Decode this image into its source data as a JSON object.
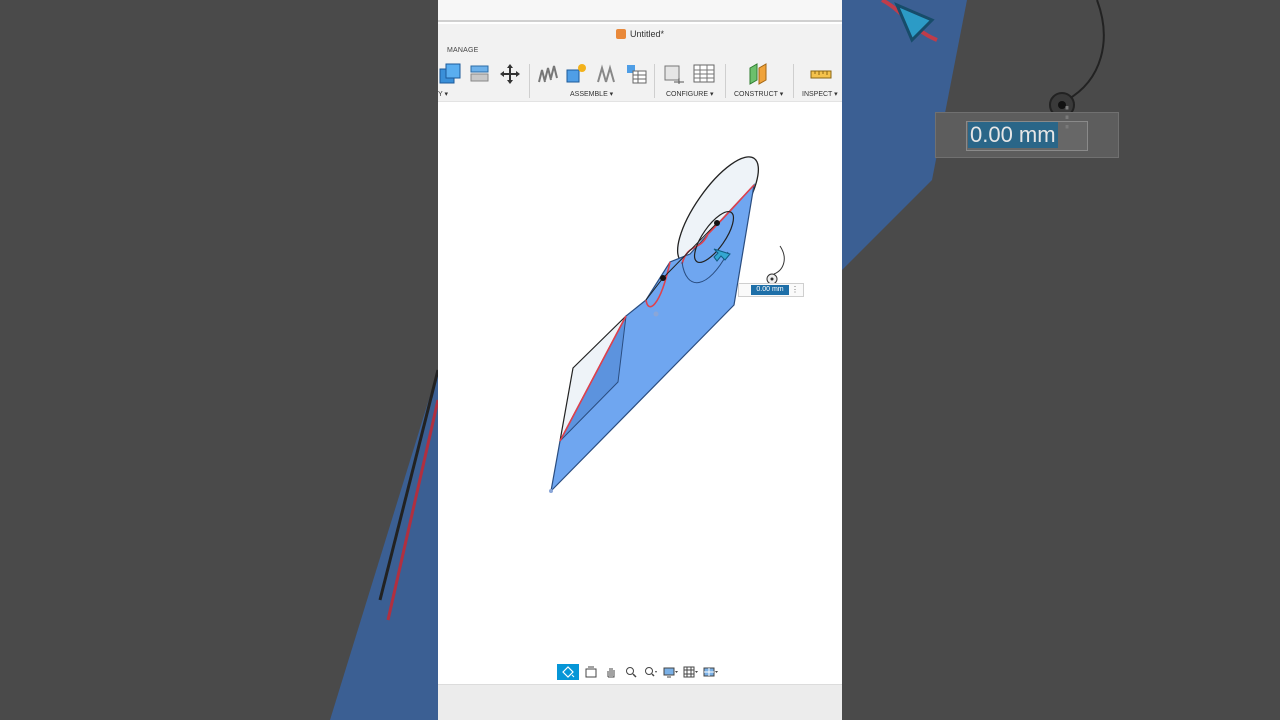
{
  "window": {
    "title": "Untitled*"
  },
  "toolbar": {
    "tab_label": "MANAGE",
    "groups": [
      {
        "label": "Y ▾"
      },
      {
        "label": "ASSEMBLE ▾"
      },
      {
        "label": "CONFIGURE ▾"
      },
      {
        "label": "CONSTRUCT ▾"
      },
      {
        "label": "INSPECT ▾"
      }
    ]
  },
  "dimension": {
    "value": "0.00 mm",
    "more_label": "⋮"
  },
  "background_zoom": {
    "value": "0.00 mm"
  },
  "colors": {
    "accent": "#0696d7",
    "body_fill": "#6fa6f0",
    "edge_highlight": "#e0404c"
  },
  "icons": {
    "doc": "document-icon",
    "nav": [
      "orbit-icon",
      "look-at-icon",
      "pan-icon",
      "zoom-window-icon",
      "zoom-icon",
      "display-settings-icon",
      "grid-icon",
      "viewports-icon"
    ]
  }
}
